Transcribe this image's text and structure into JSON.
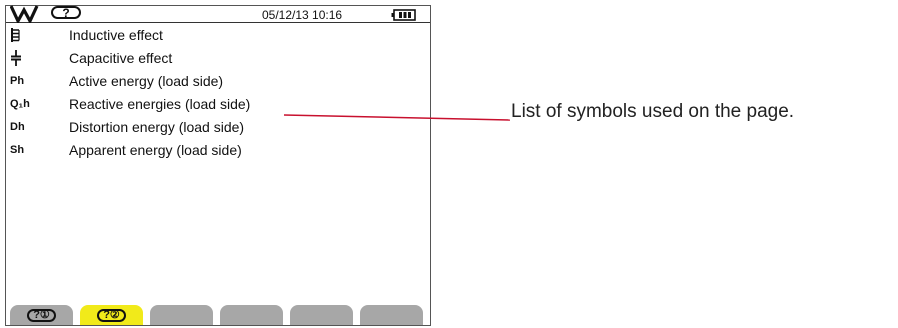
{
  "status_bar": {
    "mode_icon": "w-mode-icon",
    "help_label": "?",
    "datetime": "05/12/13 10:16",
    "battery_icon": "battery-icon"
  },
  "symbols": [
    {
      "symbol": "",
      "icon": "inductor-icon",
      "description": "Inductive effect"
    },
    {
      "symbol": "",
      "icon": "capacitor-icon",
      "description": "Capacitive effect"
    },
    {
      "symbol": "Ph",
      "description": "Active energy (load side)"
    },
    {
      "symbol": "Q₁h",
      "description": "Reactive energies (load side)"
    },
    {
      "symbol": "Dh",
      "description": "Distortion energy (load side)"
    },
    {
      "symbol": "Sh",
      "description": "Apparent energy (load side)"
    }
  ],
  "tabs": [
    {
      "label": "?①",
      "active": false
    },
    {
      "label": "?②",
      "active": true
    },
    {
      "label": "",
      "active": false
    },
    {
      "label": "",
      "active": false
    },
    {
      "label": "",
      "active": false
    },
    {
      "label": "",
      "active": false
    }
  ],
  "callout": {
    "text": "List of symbols used on the page."
  },
  "colors": {
    "active_tab": "#f1ea1a",
    "inactive_tab": "#a7a7a7",
    "leader_line": "#c8102e"
  }
}
